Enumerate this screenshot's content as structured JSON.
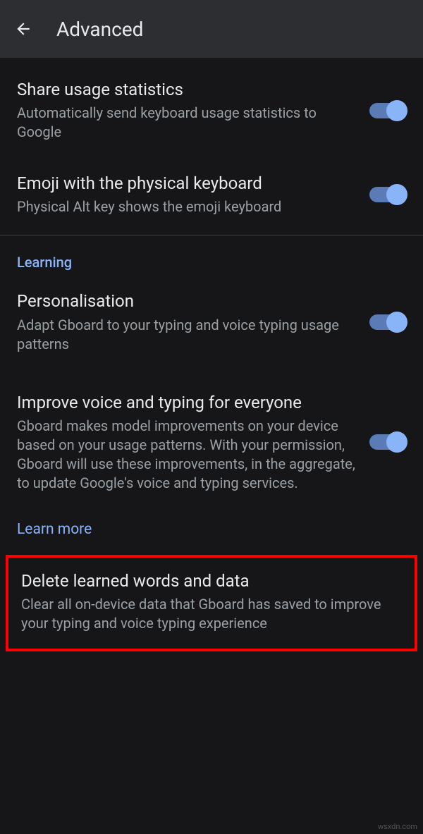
{
  "header": {
    "title": "Advanced"
  },
  "settings": {
    "share_stats": {
      "title": "Share usage statistics",
      "desc": "Automatically send keyboard usage statistics to Google"
    },
    "emoji_physical": {
      "title": "Emoji with the physical keyboard",
      "desc": "Physical Alt key shows the emoji keyboard"
    },
    "section_learning": "Learning",
    "personalisation": {
      "title": "Personalisation",
      "desc": "Adapt Gboard to your typing and voice typing usage patterns"
    },
    "improve": {
      "title": "Improve voice and typing for everyone",
      "desc": "Gboard makes model improvements on your device based on your usage patterns. With your permission, Gboard will use these improvements, in the aggregate, to update Google's voice and typing services.",
      "learn_more": "Learn more"
    },
    "delete": {
      "title": "Delete learned words and data",
      "desc": "Clear all on-device data that Gboard has saved to improve your typing and voice typing experience"
    }
  },
  "watermark": "wsxdn.com"
}
